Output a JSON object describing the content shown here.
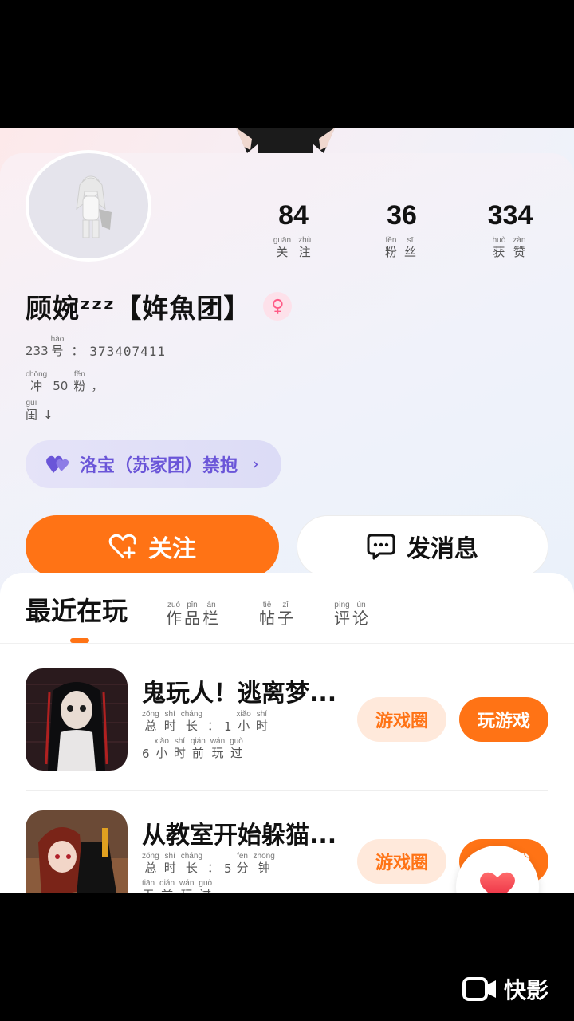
{
  "profile": {
    "username": "顾婉ᶻᶻᶻ【姩魚团】",
    "id_chars": [
      {
        "c": "233",
        "p": ""
      },
      {
        "c": "号",
        "p": "hào"
      }
    ],
    "id_sep": "：",
    "id_value": "373407411",
    "bio_line1": [
      {
        "c": "冲",
        "p": "chōng"
      },
      {
        "c": "50",
        "p": ""
      },
      {
        "c": "粉",
        "p": "fěn"
      },
      {
        "c": "，",
        "p": ""
      }
    ],
    "bio_line2": [
      {
        "c": "闺",
        "p": "guī"
      },
      {
        "c": "↓",
        "p": ""
      }
    ],
    "gender": "♀"
  },
  "stats": [
    {
      "value": "84",
      "label": [
        {
          "c": "关",
          "p": "guān"
        },
        {
          "c": "注",
          "p": "zhù"
        }
      ]
    },
    {
      "value": "36",
      "label": [
        {
          "c": "粉",
          "p": "fěn"
        },
        {
          "c": "丝",
          "p": "sī"
        }
      ]
    },
    {
      "value": "334",
      "label": [
        {
          "c": "获",
          "p": "huò"
        },
        {
          "c": "赞",
          "p": "zàn"
        }
      ]
    }
  ],
  "affinity": {
    "label": "洛宝（苏家团）禁抱",
    "accent": "#6a55d8"
  },
  "actions": {
    "follow_label": "关注",
    "message_label": "发消息",
    "brand_color": "#ff7315"
  },
  "tabs": {
    "active": "最近在玩",
    "items": [
      [
        {
          "c": "作",
          "p": "zuò"
        },
        {
          "c": "品",
          "p": "pǐn"
        },
        {
          "c": "栏",
          "p": "lán"
        }
      ],
      [
        {
          "c": "帖",
          "p": "tiě"
        },
        {
          "c": "子",
          "p": "zǐ"
        }
      ],
      [
        {
          "c": "评",
          "p": "píng"
        },
        {
          "c": "论",
          "p": "lùn"
        }
      ]
    ]
  },
  "games": [
    {
      "title": "鬼玩人！逃离梦...",
      "meta1": [
        {
          "c": "总",
          "p": "zǒng"
        },
        {
          "c": "时",
          "p": "shí"
        },
        {
          "c": "长",
          "p": "cháng"
        },
        {
          "c": "：",
          "p": ""
        },
        {
          "c": "1",
          "p": ""
        },
        {
          "c": "小",
          "p": "xiǎo"
        },
        {
          "c": "时",
          "p": "shí"
        }
      ],
      "meta2": [
        {
          "c": "6",
          "p": ""
        },
        {
          "c": "小",
          "p": "xiǎo"
        },
        {
          "c": "时",
          "p": "shí"
        },
        {
          "c": "前",
          "p": "qián"
        },
        {
          "c": "玩",
          "p": "wán"
        },
        {
          "c": "过",
          "p": "guò"
        }
      ],
      "circle_label": "游戏圈",
      "play_label": "玩游戏"
    },
    {
      "title": "从教室开始躲猫...",
      "meta1": [
        {
          "c": "总",
          "p": "zǒng"
        },
        {
          "c": "时",
          "p": "shí"
        },
        {
          "c": "长",
          "p": "cháng"
        },
        {
          "c": "：",
          "p": ""
        },
        {
          "c": "5",
          "p": ""
        },
        {
          "c": "分",
          "p": "fēn"
        },
        {
          "c": "钟",
          "p": "zhōng"
        }
      ],
      "meta2": [
        {
          "c": "天",
          "p": "tiān"
        },
        {
          "c": "前",
          "p": "qián"
        },
        {
          "c": "玩",
          "p": "wán"
        },
        {
          "c": "过",
          "p": "guò"
        }
      ],
      "circle_label": "游戏圈",
      "play_label": "玩游戏"
    }
  ],
  "watermark": "快影"
}
